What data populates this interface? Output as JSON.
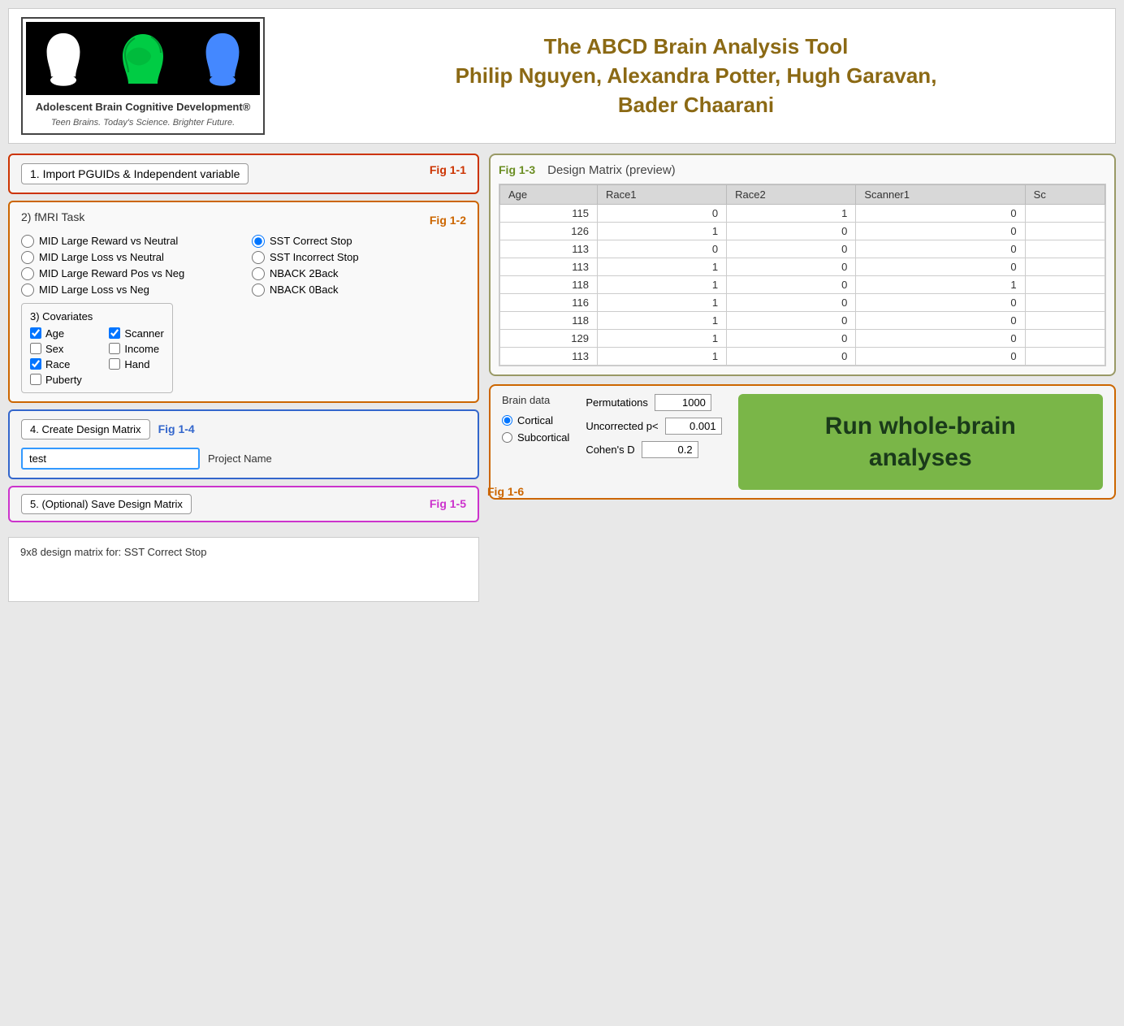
{
  "header": {
    "title_line1": "The ABCD Brain Analysis Tool",
    "title_line2": "Philip Nguyen, Alexandra Potter, Hugh Garavan,",
    "title_line3": "Bader Chaarani",
    "logo_main": "Adolescent Brain Cognitive Development®",
    "logo_sub": "Teen Brains. Today's Science. Brighter Future."
  },
  "section1": {
    "label": "1. Import PGUIDs & Independent variable",
    "fig": "Fig 1-1"
  },
  "section2": {
    "label": "2) fMRI Task",
    "fig": "Fig 1-2",
    "options": [
      {
        "id": "mid_large_reward",
        "label": "MID Large Reward vs Neutral",
        "checked": false
      },
      {
        "id": "sst_correct_stop",
        "label": "SST Correct Stop",
        "checked": true
      },
      {
        "id": "mid_large_loss",
        "label": "MID Large Loss vs Neutral",
        "checked": false
      },
      {
        "id": "sst_incorrect_stop",
        "label": "SST Incorrect Stop",
        "checked": false
      },
      {
        "id": "mid_reward_pos",
        "label": "MID Large Reward Pos vs Neg",
        "checked": false
      },
      {
        "id": "nback_2back",
        "label": "NBACK 2Back",
        "checked": false
      },
      {
        "id": "mid_loss_neg",
        "label": "MID Large Loss vs Neg",
        "checked": false
      },
      {
        "id": "nback_0back",
        "label": "NBACK 0Back",
        "checked": false
      }
    ],
    "covariates_title": "3) Covariates",
    "covariates": [
      {
        "label": "Age",
        "checked": true
      },
      {
        "label": "Scanner",
        "checked": true
      },
      {
        "label": "Sex",
        "checked": false
      },
      {
        "label": "Income",
        "checked": false
      },
      {
        "label": "Race",
        "checked": true
      },
      {
        "label": "Hand",
        "checked": false
      },
      {
        "label": "Puberty",
        "checked": false
      }
    ]
  },
  "section4": {
    "button_label": "4. Create Design Matrix",
    "fig": "Fig 1-4",
    "project_value": "test",
    "project_placeholder": "Project Name",
    "project_label": "Project Name"
  },
  "section5": {
    "button_label": "5. (Optional) Save Design Matrix",
    "fig": "Fig 1-5"
  },
  "design_matrix": {
    "fig": "Fig 1-3",
    "title": "Design Matrix (preview)",
    "columns": [
      "Age",
      "Race1",
      "Race2",
      "Scanner1",
      "Sc"
    ],
    "rows": [
      [
        115,
        0,
        1,
        0,
        ""
      ],
      [
        126,
        1,
        0,
        0,
        ""
      ],
      [
        113,
        0,
        0,
        0,
        ""
      ],
      [
        113,
        1,
        0,
        0,
        ""
      ],
      [
        118,
        1,
        0,
        1,
        ""
      ],
      [
        116,
        1,
        0,
        0,
        ""
      ],
      [
        118,
        1,
        0,
        0,
        ""
      ],
      [
        129,
        1,
        0,
        0,
        ""
      ],
      [
        113,
        1,
        0,
        0,
        ""
      ]
    ]
  },
  "brain_data": {
    "title": "Brain data",
    "options": [
      {
        "label": "Cortical",
        "checked": true
      },
      {
        "label": "Subcortical",
        "checked": false
      }
    ]
  },
  "params": {
    "permutations_label": "Permutations",
    "permutations_value": "1000",
    "uncorrected_label": "Uncorrected p<",
    "uncorrected_value": "0.001",
    "cohen_label": "Cohen's D",
    "cohen_value": "0.2"
  },
  "fig16": "Fig 1-6",
  "run_button": "Run whole-brain\nanalyses",
  "status_text": "9x8 design matrix for: SST Correct Stop"
}
